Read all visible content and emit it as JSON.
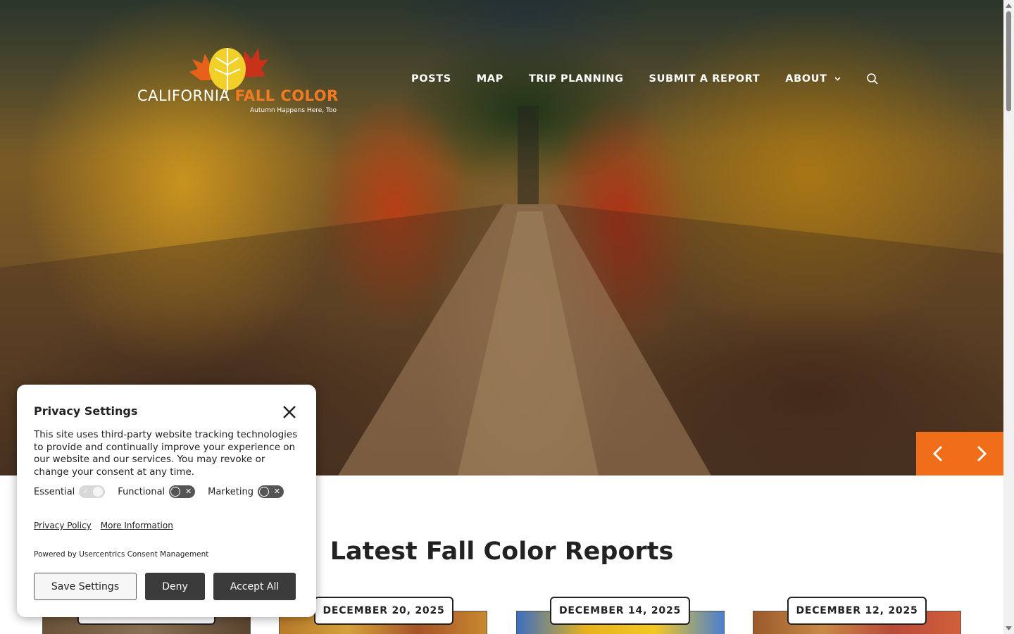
{
  "site": {
    "logo": {
      "name_part1": "CALIFORNIA",
      "name_part2": "FALL COLOR",
      "tagline": "Autumn Happens Here, Too"
    },
    "nav": {
      "items": [
        {
          "label": "POSTS"
        },
        {
          "label": "MAP"
        },
        {
          "label": "TRIP PLANNING"
        },
        {
          "label": "SUBMIT A REPORT"
        },
        {
          "label": "ABOUT"
        }
      ],
      "search_icon": "search-icon"
    },
    "hero": {
      "image": "vineyard-row-autumn",
      "prev_icon": "chevron-left-icon",
      "next_icon": "chevron-right-icon"
    }
  },
  "main": {
    "section_title": "Latest Fall Color Reports",
    "cards": [
      {
        "date": ""
      },
      {
        "date": "DECEMBER 20, 2025"
      },
      {
        "date": "DECEMBER 14, 2025"
      },
      {
        "date": "DECEMBER 12, 2025"
      }
    ]
  },
  "privacy": {
    "title": "Privacy Settings",
    "description": "This site uses third-party website tracking technologies to provide and continually improve your experience on our website and our services. You may revoke or change your consent at any time.",
    "toggles": [
      {
        "label": "Essential",
        "state": "on-disabled"
      },
      {
        "label": "Functional",
        "state": "off"
      },
      {
        "label": "Marketing",
        "state": "off"
      }
    ],
    "links": {
      "privacy_policy": "Privacy Policy",
      "more_information": "More Information"
    },
    "powered_by": "Powered by Usercentrics Consent Management",
    "buttons": {
      "save": "Save Settings",
      "deny": "Deny",
      "accept": "Accept All"
    }
  },
  "colors": {
    "accent": "#f06e1a",
    "button_dark": "#3b3b3b"
  }
}
